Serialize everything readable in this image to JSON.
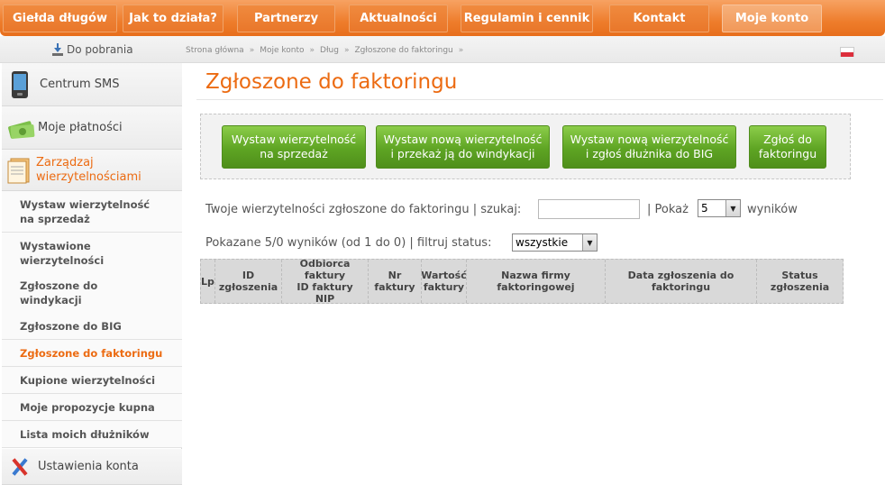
{
  "nav": {
    "items": [
      "Giełda długów",
      "Jak to działa?",
      "Partnerzy",
      "Aktualności",
      "Regulamin i cennik",
      "Kontakt",
      "Moje konto"
    ],
    "active": "Moje konto"
  },
  "subbar": {
    "download_label": "Do pobrania",
    "breadcrumb": [
      "Strona główna",
      "Moje konto",
      "Dług",
      "Zgłoszone do faktoringu"
    ],
    "sep": "»"
  },
  "sidebar": {
    "centrum_sms": "Centrum SMS",
    "moje_platnosci": "Moje płatności",
    "zarzadzaj": "Zarządzaj\nwierzytelnościami",
    "sub": [
      "Wystaw wierzytelność\nna sprzedaż",
      "Wystawione\nwierzytelności",
      "Zgłoszone do\nwindykacji",
      "Zgłoszone do BIG",
      "Zgłoszone do faktoringu",
      "Kupione wierzytelności",
      "Moje propozycje kupna",
      "Lista moich dłużników"
    ],
    "ustawienia": "Ustawienia konta"
  },
  "main": {
    "title": "Zgłoszone do faktoringu",
    "buttons": [
      "Wystaw wierzytelność\nna sprzedaż",
      "Wystaw nową wierzytelność\ni przekaż ją do windykacji",
      "Wystaw nową wierzytelność\ni zgłoś dłużnika do BIG",
      "Zgłoś do\nfaktoringu"
    ],
    "filter": {
      "prefix": "Twoje wierzytelności zgłoszone do faktoringu | szukaj:",
      "search_value": "",
      "show_label": "| Pokaż",
      "show_value": "5",
      "results_label": "wyników",
      "shown_text": "Pokazane 5/0 wyników (od 1 do 0) | filtruj status:",
      "status_value": "wszystkie"
    },
    "table_headers": [
      "Lp",
      "ID zgłoszenia",
      "Odbiorca faktury\nID faktury\nNIP",
      "Nr faktury",
      "Wartość\nfaktury",
      "Nazwa firmy faktoringowej",
      "Data zgłoszenia do faktoringu",
      "Status zgłoszenia"
    ]
  },
  "colors": {
    "accent": "#ec6b12",
    "nav_orange": "#ee7d2c",
    "button_green": "#5ea423"
  }
}
